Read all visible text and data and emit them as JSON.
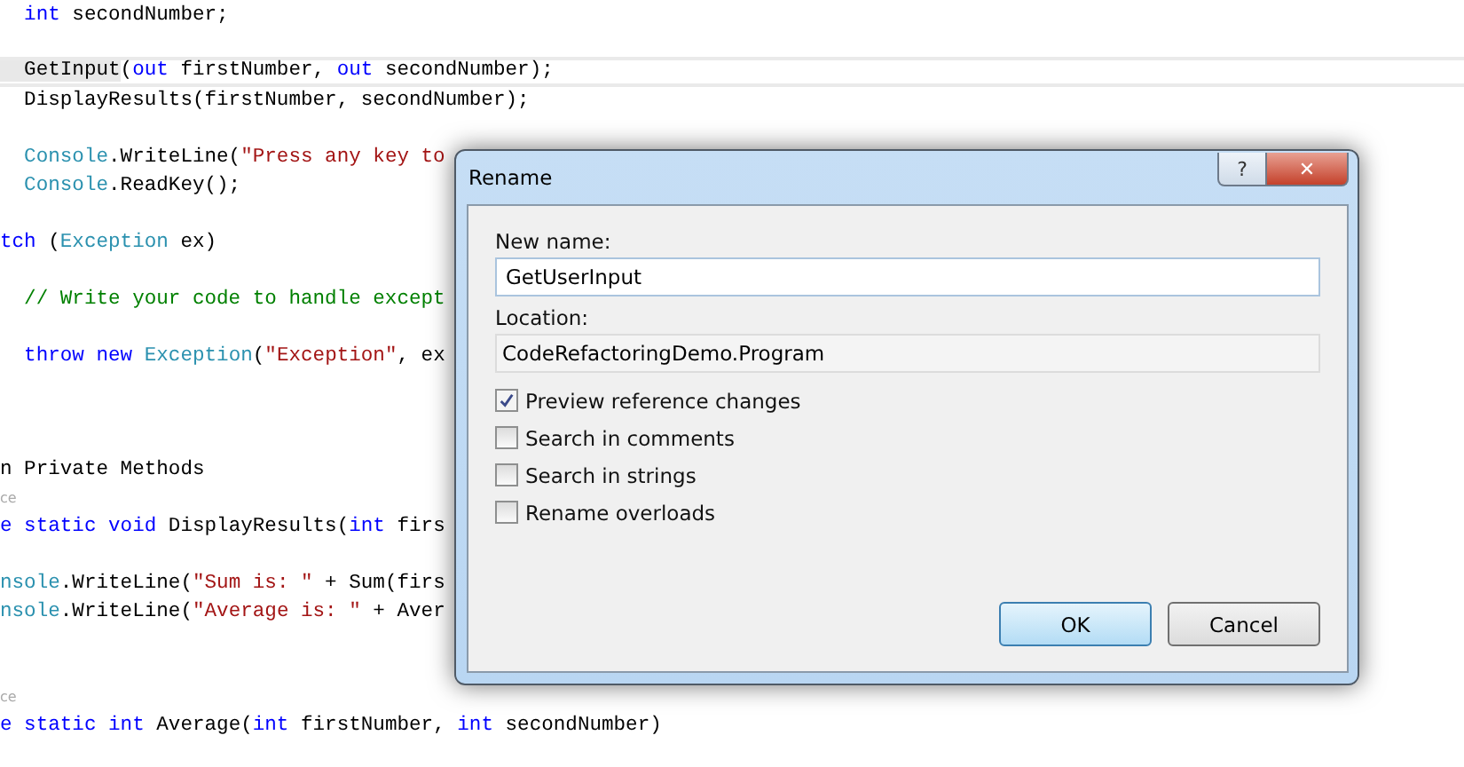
{
  "editor": {
    "lines": [
      {
        "kind": "code",
        "current": false,
        "tokens": [
          {
            "t": "  int",
            "kind": "keyword"
          },
          {
            "t": " secondNumber;",
            "kind": "plain"
          }
        ]
      },
      {
        "kind": "blank"
      },
      {
        "kind": "code",
        "current": true,
        "tokens": [
          {
            "t": "  GetInput",
            "kind": "reference"
          },
          {
            "t": "(",
            "kind": "plain"
          },
          {
            "t": "out",
            "kind": "keyword"
          },
          {
            "t": " firstNumber, ",
            "kind": "plain"
          },
          {
            "t": "out",
            "kind": "keyword"
          },
          {
            "t": " secondNumber);",
            "kind": "plain"
          }
        ]
      },
      {
        "kind": "code",
        "current": false,
        "tokens": [
          {
            "t": "  DisplayResults(firstNumber, secondNumber);",
            "kind": "plain"
          }
        ]
      },
      {
        "kind": "blank"
      },
      {
        "kind": "code",
        "current": false,
        "tokens": [
          {
            "t": "  Console",
            "kind": "type"
          },
          {
            "t": ".WriteLine(",
            "kind": "plain"
          },
          {
            "t": "\"Press any key to",
            "kind": "string"
          }
        ]
      },
      {
        "kind": "code",
        "current": false,
        "tokens": [
          {
            "t": "  Console",
            "kind": "type"
          },
          {
            "t": ".ReadKey();",
            "kind": "plain"
          }
        ]
      },
      {
        "kind": "blank"
      },
      {
        "kind": "code",
        "current": false,
        "tokens": [
          {
            "t": "tch",
            "kind": "keyword"
          },
          {
            "t": " (",
            "kind": "plain"
          },
          {
            "t": "Exception",
            "kind": "type"
          },
          {
            "t": " ex)",
            "kind": "plain"
          }
        ]
      },
      {
        "kind": "blank"
      },
      {
        "kind": "code",
        "current": false,
        "tokens": [
          {
            "t": "  // Write your code to handle except",
            "kind": "comment"
          }
        ]
      },
      {
        "kind": "blank"
      },
      {
        "kind": "code",
        "current": false,
        "tokens": [
          {
            "t": "  throw",
            "kind": "keyword"
          },
          {
            "t": " new",
            "kind": "keyword"
          },
          {
            "t": " Exception",
            "kind": "type"
          },
          {
            "t": "(",
            "kind": "plain"
          },
          {
            "t": "\"Exception\"",
            "kind": "string"
          },
          {
            "t": ", ex",
            "kind": "plain"
          }
        ]
      },
      {
        "kind": "blank"
      },
      {
        "kind": "blank"
      },
      {
        "kind": "blank"
      },
      {
        "kind": "code",
        "current": false,
        "tokens": [
          {
            "t": "n Private Methods",
            "kind": "plain"
          }
        ]
      },
      {
        "kind": "lens",
        "text": "ce"
      },
      {
        "kind": "code",
        "current": false,
        "tokens": [
          {
            "t": "e static",
            "kind": "keyword"
          },
          {
            "t": " void",
            "kind": "keyword"
          },
          {
            "t": " DisplayResults(",
            "kind": "plain"
          },
          {
            "t": "int",
            "kind": "keyword"
          },
          {
            "t": " firs",
            "kind": "plain"
          }
        ]
      },
      {
        "kind": "blank"
      },
      {
        "kind": "code",
        "current": false,
        "tokens": [
          {
            "t": "nsole",
            "kind": "type"
          },
          {
            "t": ".WriteLine(",
            "kind": "plain"
          },
          {
            "t": "\"Sum is: \"",
            "kind": "string"
          },
          {
            "t": " + Sum(firs",
            "kind": "plain"
          }
        ]
      },
      {
        "kind": "code",
        "current": false,
        "tokens": [
          {
            "t": "nsole",
            "kind": "type"
          },
          {
            "t": ".WriteLine(",
            "kind": "plain"
          },
          {
            "t": "\"Average is: \"",
            "kind": "string"
          },
          {
            "t": " + Aver",
            "kind": "plain"
          }
        ]
      },
      {
        "kind": "blank"
      },
      {
        "kind": "blank"
      },
      {
        "kind": "lens",
        "text": "ce"
      },
      {
        "kind": "code",
        "current": false,
        "tokens": [
          {
            "t": "e static",
            "kind": "keyword"
          },
          {
            "t": " int",
            "kind": "keyword"
          },
          {
            "t": " Average(",
            "kind": "plain"
          },
          {
            "t": "int",
            "kind": "keyword"
          },
          {
            "t": " firstNumber, ",
            "kind": "plain"
          },
          {
            "t": "int",
            "kind": "keyword"
          },
          {
            "t": " secondNumber)",
            "kind": "plain"
          }
        ]
      }
    ]
  },
  "dialog": {
    "title": "Rename",
    "help_button": "?",
    "close_button": "✕",
    "new_name_label": "New name:",
    "new_name_value": "GetUserInput",
    "location_label": "Location:",
    "location_value": "CodeRefactoringDemo.Program",
    "options": [
      {
        "label": "Preview reference changes",
        "checked": true
      },
      {
        "label": "Search in comments",
        "checked": false
      },
      {
        "label": "Search in strings",
        "checked": false
      },
      {
        "label": "Rename overloads",
        "checked": false
      }
    ],
    "buttons": [
      {
        "label": "OK",
        "default": true
      },
      {
        "label": "Cancel",
        "default": false
      }
    ]
  }
}
